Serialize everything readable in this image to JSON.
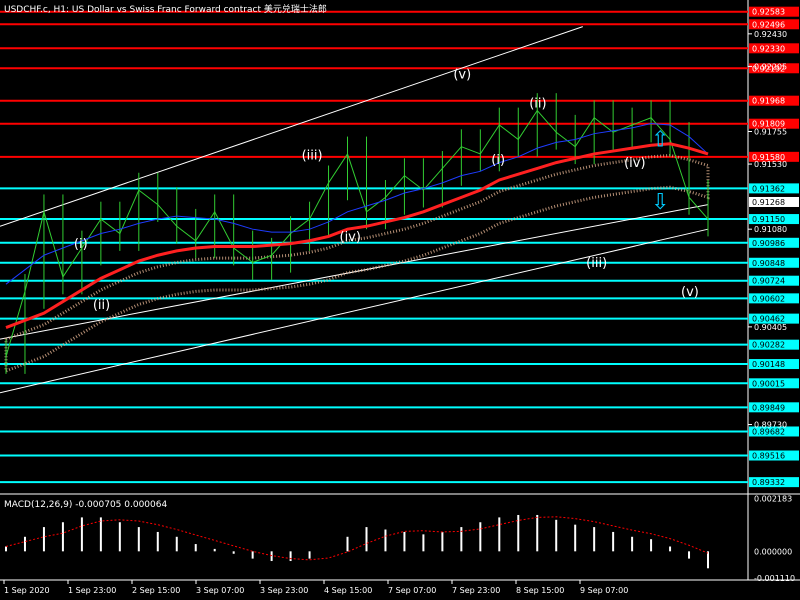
{
  "header": {
    "symbol_line": "USDCHF.c, H1: US Dollar vs Swiss Franc Forward contract  美元兑瑞士法郎"
  },
  "indicator": {
    "label": "MACD(12,26,9) -0.000705 0.000064",
    "scale": [
      "0.002183",
      "0.000000",
      "-0.001110"
    ]
  },
  "chart_data": {
    "type": "candlestick",
    "symbol": "USDCHF.c",
    "timeframe": "H1",
    "ylim": [
      0.8925,
      0.9265
    ],
    "x_ticks": [
      "1 Sep 2020",
      "1 Sep 23:00",
      "2 Sep 15:00",
      "3 Sep 07:00",
      "3 Sep 23:00",
      "4 Sep 15:00",
      "7 Sep 07:00",
      "7 Sep 23:00",
      "8 Sep 15:00",
      "9 Sep 07:00"
    ],
    "y_ticks": [
      0.9243,
      0.92205,
      0.91755,
      0.9153,
      0.9108,
      0.90405,
      0.8973
    ],
    "price_levels_red": [
      0.92583,
      0.92496,
      0.9233,
      0.92192,
      0.91968,
      0.91809,
      0.9158
    ],
    "price_levels_cyan": [
      0.91362,
      0.9115,
      0.90986,
      0.90848,
      0.90724,
      0.90602,
      0.90462,
      0.90282,
      0.90148,
      0.90015,
      0.89849,
      0.89682,
      0.89516,
      0.89332
    ],
    "current_price": 0.91268,
    "series": [
      {
        "name": "close",
        "values": [
          0.902,
          0.9065,
          0.912,
          0.9075,
          0.9095,
          0.9115,
          0.9105,
          0.9135,
          0.9125,
          0.911,
          0.91,
          0.912,
          0.9095,
          0.9085,
          0.909,
          0.9105,
          0.9115,
          0.914,
          0.916,
          0.912,
          0.913,
          0.9145,
          0.9135,
          0.915,
          0.9165,
          0.916,
          0.918,
          0.917,
          0.919,
          0.9175,
          0.9165,
          0.9185,
          0.9175,
          0.918,
          0.9185,
          0.917,
          0.913,
          0.9115
        ]
      },
      {
        "name": "ma_fast",
        "values": [
          0.907,
          0.908,
          0.909,
          0.9095,
          0.91,
          0.9105,
          0.9108,
          0.9112,
          0.9115,
          0.9117,
          0.9116,
          0.9115,
          0.9112,
          0.9108,
          0.9106,
          0.9106,
          0.9108,
          0.9113,
          0.912,
          0.9124,
          0.9128,
          0.9133,
          0.9136,
          0.914,
          0.9145,
          0.9148,
          0.9154,
          0.9158,
          0.9164,
          0.9168,
          0.917,
          0.9174,
          0.9176,
          0.9178,
          0.9181,
          0.918,
          0.9172,
          0.916
        ]
      },
      {
        "name": "ma_slow",
        "values": [
          0.904,
          0.9045,
          0.905,
          0.9058,
          0.9066,
          0.9074,
          0.908,
          0.9086,
          0.909,
          0.9093,
          0.9095,
          0.9096,
          0.9096,
          0.9096,
          0.9097,
          0.9098,
          0.91,
          0.9103,
          0.9108,
          0.911,
          0.9113,
          0.9116,
          0.912,
          0.9125,
          0.913,
          0.9135,
          0.9142,
          0.9146,
          0.915,
          0.9154,
          0.9157,
          0.916,
          0.9162,
          0.9164,
          0.9166,
          0.9167,
          0.9164,
          0.916
        ]
      },
      {
        "name": "macd",
        "values": [
          0.0002,
          0.0006,
          0.001,
          0.0012,
          0.0014,
          0.0014,
          0.0012,
          0.001,
          0.0008,
          0.0006,
          0.0003,
          0.0001,
          -0.0001,
          -0.0003,
          -0.0004,
          -0.0004,
          -0.0003,
          0.0,
          0.0006,
          0.001,
          0.0009,
          0.0008,
          0.0007,
          0.0008,
          0.001,
          0.0012,
          0.0014,
          0.0015,
          0.0015,
          0.0013,
          0.0011,
          0.001,
          0.0008,
          0.0006,
          0.0005,
          0.0002,
          -0.0003,
          -0.0007
        ]
      }
    ],
    "waves": [
      {
        "label": "(i)",
        "x": 4,
        "y": 0.9095
      },
      {
        "label": "(ii)",
        "x": 5,
        "y": 0.9053
      },
      {
        "label": "(iii)",
        "x": 16,
        "y": 0.9156
      },
      {
        "label": "(iv)",
        "x": 18,
        "y": 0.91
      },
      {
        "label": "(v)",
        "x": 24,
        "y": 0.9212
      },
      {
        "label": "(i)",
        "x": 26,
        "y": 0.9153
      },
      {
        "label": "(ii)",
        "x": 28,
        "y": 0.9192
      },
      {
        "label": "(iv)",
        "x": 33,
        "y": 0.9151
      },
      {
        "label": "(iii)",
        "x": 31,
        "y": 0.9082
      },
      {
        "label": "(v)",
        "x": 36,
        "y": 0.9062
      }
    ]
  },
  "colors": {
    "background": "#000000",
    "red_level": "#ff0000",
    "cyan_level": "#00ffff",
    "grid": "#2a2a2a",
    "price": "#32cd32",
    "ma_fast": "#1e3cff",
    "ma_slow": "#ff2020",
    "cloud": "#e0b090",
    "macd": "#ffffff",
    "signal": "#ff0000"
  }
}
